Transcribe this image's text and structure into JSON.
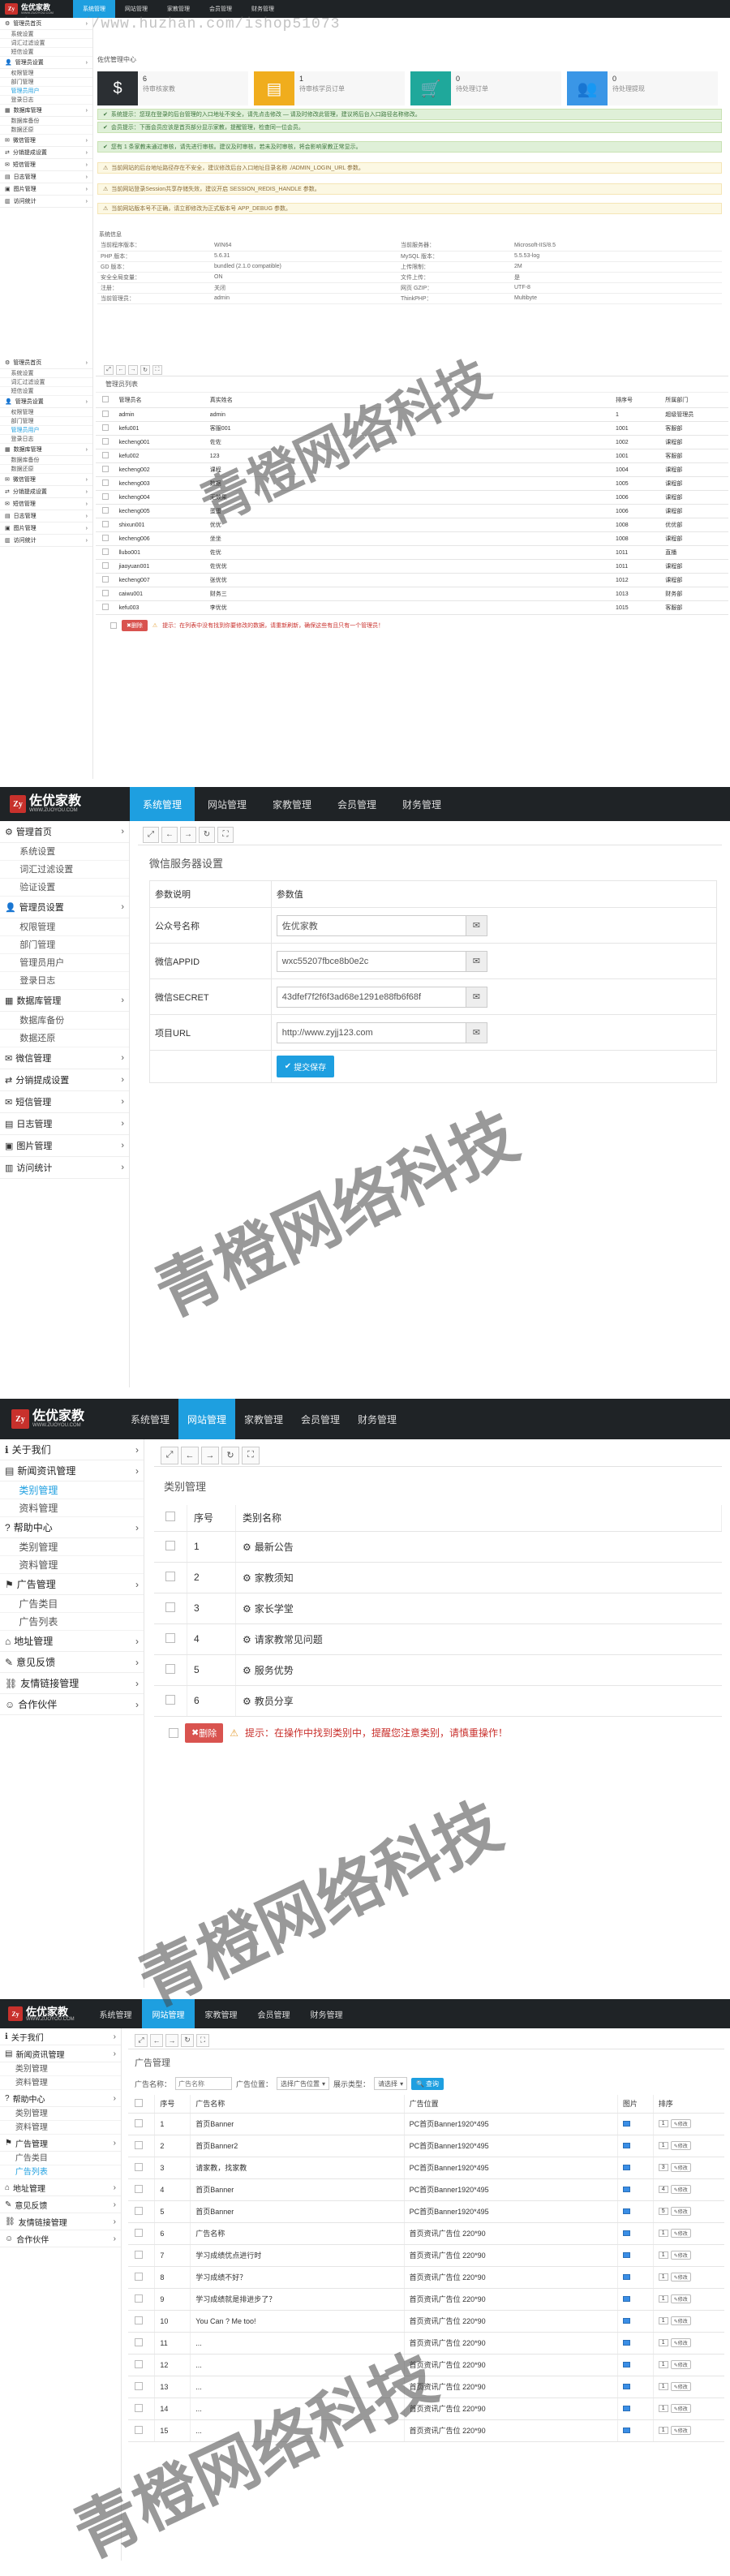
{
  "logo": {
    "name": "佐优家教",
    "sub": "WWW.ZUOYOU.COM",
    "mark": "Zy"
  },
  "nav": [
    "系统管理",
    "网站管理",
    "家教管理",
    "会员管理",
    "财务管理"
  ],
  "url_overlay": "https://www.huzhan.com/ishop51073",
  "watermark": "青橙网络科技",
  "panel1": {
    "welcome": "佐优管理中心",
    "stats": [
      {
        "num": "6",
        "label": "待审核家教"
      },
      {
        "num": "1",
        "label": "待审核学员订单"
      },
      {
        "num": "0",
        "label": "待处理订单"
      },
      {
        "num": "0",
        "label": "待处理提现"
      }
    ],
    "stat_colors": [
      "#2b2f33",
      "#f0ad1d",
      "#1fa89b",
      "#3a96e6"
    ],
    "notices": [
      {
        "type": "ok",
        "text": "系统提示：您现在登录的后台管理的入口地址不安全，请先点击修改 — 请及时修改此管理，建议将后台入口路径名称修改。"
      },
      {
        "type": "ok",
        "text": "会员提示：下面会员应该是首页部分显示家教，提醒管理，检查同一位会员。"
      },
      {
        "type": "ok",
        "text": "您有 1 条家教未通过审核，请先进行审核。建议及时审核，若未及时审核，将会影响家教正常显示。"
      },
      {
        "type": "warn",
        "text": "当前网站的后台地址路径存在不安全，建议修改后台入口地址目录名称 ./ADMIN_LOGIN_URL 参数。"
      },
      {
        "type": "warn",
        "text": "当前网站登录Session共享存储失效，建议开启 SESSION_REDIS_HANDLE 参数。"
      },
      {
        "type": "warn",
        "text": "当前网站版本号不正确，请立即修改为正式版本号 APP_DEBUG 参数。"
      }
    ],
    "sys_title": "系统信息",
    "sys_rows": [
      [
        "当前程序版本：",
        "WIN64",
        "当前服务器：",
        "Microsoft-IIS/8.5"
      ],
      [
        "PHP 版本：",
        "5.6.31",
        "MySQL 版本：",
        "5.5.53-log"
      ],
      [
        "GD 版本：",
        "bundled (2.1.0 compatible)",
        "上传限制：",
        "2M"
      ],
      [
        "安全全局变量：",
        "ON",
        "文件上传：",
        "是"
      ],
      [
        "注册：",
        "关闭",
        "网页 GZIP：",
        "UTF-8"
      ],
      [
        "当前管理员：",
        "admin",
        "ThinkPHP：",
        "Multibyte"
      ]
    ],
    "sidebar_groups": [
      {
        "label": "管理员首页",
        "items": [
          "系统设置",
          "词汇过滤设置",
          "短信设置"
        ]
      },
      {
        "label": "管理员设置",
        "items": [
          "权限管理",
          "部门管理",
          "管理员用户",
          "登录日志"
        ]
      },
      {
        "label": "数据库管理",
        "items": [
          "数据库备份",
          "数据还原"
        ]
      },
      {
        "label": "微信管理",
        "items": []
      },
      {
        "label": "分销提成设置",
        "items": []
      },
      {
        "label": "短信管理",
        "items": []
      },
      {
        "label": "日志管理",
        "items": []
      },
      {
        "label": "图片管理",
        "items": []
      },
      {
        "label": "访问统计",
        "items": []
      }
    ]
  },
  "panel2": {
    "table_title": "管理员列表",
    "headers": [
      "管理员名",
      "真实姓名",
      "排序号",
      "所属部门"
    ],
    "rows": [
      [
        "admin",
        "admin",
        "1",
        "超级管理员"
      ],
      [
        "kefu001",
        "客服001",
        "1001",
        "客服部"
      ],
      [
        "kecheng001",
        "佐佐",
        "1002",
        "课程部"
      ],
      [
        "kefu002",
        "123",
        "1001",
        "客服部"
      ],
      [
        "kecheng002",
        "课程",
        "1004",
        "课程部"
      ],
      [
        "kecheng003",
        "数据",
        "1005",
        "课程部"
      ],
      [
        "kecheng004",
        "无效果",
        "1006",
        "课程部"
      ],
      [
        "kecheng005",
        "蛋蛋",
        "1006",
        "课程部"
      ],
      [
        "shixun001",
        "优优",
        "1008",
        "优优部"
      ],
      [
        "kecheng006",
        "坐坐",
        "1008",
        "课程部"
      ],
      [
        "llubo001",
        "佐优",
        "1011",
        "直播"
      ],
      [
        "jiaoyuan001",
        "佐优优",
        "1011",
        "课程部"
      ],
      [
        "kecheng007",
        "张优优",
        "1012",
        "课程部"
      ],
      [
        "caiwu001",
        "财务三",
        "1013",
        "财务部"
      ],
      [
        "kefu003",
        "李优优",
        "1015",
        "客服部"
      ]
    ],
    "del_label": "删除",
    "warn_text": "提示：在列表中没有找到你要修改的数据，请重新刷新，确保这些有且只有一个管理员！"
  },
  "panel3": {
    "section_title": "微信服务器设置",
    "col_headers": [
      "参数说明",
      "参数值"
    ],
    "fields": [
      {
        "label": "公众号名称",
        "value": "佐优家教"
      },
      {
        "label": "微信APPID",
        "value": "wxc55207fbce8b0e2c"
      },
      {
        "label": "微信SECRET",
        "value": "43dfef7f2f6f3ad68e1291e88fb6f68f"
      },
      {
        "label": "项目URL",
        "value": "http://www.zyjj123.com"
      }
    ],
    "submit": "提交保存",
    "sidebar_groups": [
      {
        "label": "管理首页",
        "items": [
          "系统设置",
          "词汇过滤设置",
          "验证设置"
        ]
      },
      {
        "label": "管理员设置",
        "items": [
          "权限管理",
          "部门管理",
          "管理员用户",
          "登录日志"
        ]
      },
      {
        "label": "数据库管理",
        "items": [
          "数据库备份",
          "数据还原"
        ]
      },
      {
        "label": "微信管理",
        "items": []
      },
      {
        "label": "分销提成设置",
        "items": []
      },
      {
        "label": "短信管理",
        "items": []
      },
      {
        "label": "日志管理",
        "items": []
      },
      {
        "label": "图片管理",
        "items": []
      },
      {
        "label": "访问统计",
        "items": []
      }
    ]
  },
  "panel4": {
    "section_title": "类别管理",
    "headers": [
      "序号",
      "类别名称"
    ],
    "rows": [
      [
        "1",
        "最新公告"
      ],
      [
        "2",
        "家教须知"
      ],
      [
        "3",
        "家长学堂"
      ],
      [
        "4",
        "请家教常见问题"
      ],
      [
        "5",
        "服务优势"
      ],
      [
        "6",
        "教员分享"
      ]
    ],
    "del_label": "删除",
    "warn_text": "提示：在操作中找到类别中，提醒您注意类别，请慎重操作！",
    "sidebar_groups": [
      {
        "label": "关于我们",
        "items": []
      },
      {
        "label": "新闻资讯管理",
        "items": [
          "类别管理",
          "资料管理"
        ]
      },
      {
        "label": "帮助中心",
        "items": [
          "类别管理",
          "资料管理"
        ]
      },
      {
        "label": "广告管理",
        "items": [
          "广告类目",
          "广告列表"
        ]
      },
      {
        "label": "地址管理",
        "items": []
      },
      {
        "label": "意见反馈",
        "items": []
      },
      {
        "label": "友情链接管理",
        "items": []
      },
      {
        "label": "合作伙伴",
        "items": []
      }
    ]
  },
  "panel5": {
    "section_title": "广告管理",
    "filter_name_label": "广告名称：",
    "filter_name_placeholder": "广告名称",
    "filter_pos_label": "广告位置：",
    "filter_pos_value": "选择广告位置",
    "filter_type_label": "展示类型：",
    "filter_type_value": "请选择",
    "search_label": "查询",
    "headers": [
      "序号",
      "广告名称",
      "广告位置",
      "图片",
      "排序"
    ],
    "rows": [
      [
        "1",
        "首页Banner",
        "PC首页Banner1920*495",
        "1"
      ],
      [
        "2",
        "首页Banner2",
        "PC首页Banner1920*495",
        "1"
      ],
      [
        "3",
        "请家教，找家教",
        "PC首页Banner1920*495",
        "3"
      ],
      [
        "4",
        "首页Banner",
        "PC首页Banner1920*495",
        "4"
      ],
      [
        "5",
        "首页Banner",
        "PC首页Banner1920*495",
        "5"
      ],
      [
        "6",
        "广告名称",
        "首页资讯广告位 220*90",
        "1"
      ],
      [
        "7",
        "学习成绩优点进行时",
        "首页资讯广告位 220*90",
        "1"
      ],
      [
        "8",
        "学习成绩不好？",
        "首页资讯广告位 220*90",
        "1"
      ],
      [
        "9",
        "学习成绩就是排进步了？",
        "首页资讯广告位 220*90",
        "1"
      ],
      [
        "10",
        "You Can ? Me too!",
        "首页资讯广告位 220*90",
        "1"
      ],
      [
        "11",
        "...",
        "首页资讯广告位 220*90",
        "1"
      ],
      [
        "12",
        "...",
        "首页资讯广告位 220*90",
        "1"
      ],
      [
        "13",
        "...",
        "首页资讯广告位 220*90",
        "1"
      ],
      [
        "14",
        "...",
        "首页资讯广告位 220*90",
        "1"
      ],
      [
        "15",
        "...",
        "首页资讯广告位 220*90",
        "1"
      ]
    ],
    "action_label": "修改",
    "sidebar_groups": [
      {
        "label": "关于我们",
        "items": []
      },
      {
        "label": "新闻资讯管理",
        "items": [
          "类别管理",
          "资料管理"
        ]
      },
      {
        "label": "帮助中心",
        "items": [
          "类别管理",
          "资料管理"
        ]
      },
      {
        "label": "广告管理",
        "items": [
          "广告类目",
          "广告列表"
        ]
      },
      {
        "label": "地址管理",
        "items": []
      },
      {
        "label": "意见反馈",
        "items": []
      },
      {
        "label": "友情链接管理",
        "items": []
      },
      {
        "label": "合作伙伴",
        "items": []
      }
    ]
  }
}
